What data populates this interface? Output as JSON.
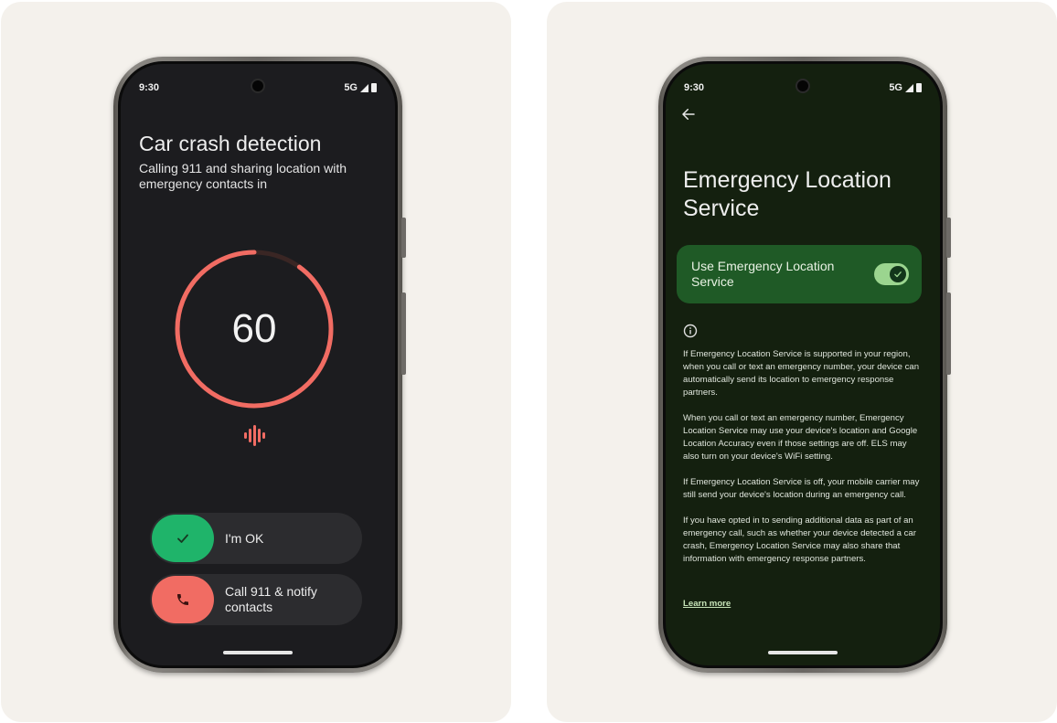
{
  "left_phone": {
    "status": {
      "time": "9:30",
      "network": "5G"
    },
    "title": "Car crash detection",
    "subtitle": "Calling 911 and sharing location with emergency contacts in",
    "countdown": {
      "value": "60",
      "progress_fraction": 0.9,
      "ring_color": "#f16c63"
    },
    "actions": {
      "ok_label": "I'm OK",
      "call_label": "Call 911 & notify contacts"
    },
    "colors": {
      "ok_green": "#1fb46a",
      "call_red": "#f16c63"
    }
  },
  "right_phone": {
    "status": {
      "time": "9:30",
      "network": "5G"
    },
    "title": "Emergency Location Service",
    "toggle": {
      "label": "Use Emergency Location Service",
      "checked": true
    },
    "paragraphs": [
      "If Emergency Location Service is supported in your region, when you call or text an emergency number, your device can automatically send its location to emergency response partners.",
      "When you call or text an emergency number, Emergency Location Service may use your device's location and Google Location Accuracy even if those settings are off. ELS may also turn on your device's WiFi setting.",
      "If Emergency Location Service is off, your mobile carrier may still send your device's location during an emergency call.",
      "If you have opted in to sending additional data as part of an emergency call, such as whether your device detected a car crash, Emergency Location Service may also share that information with emergency response partners."
    ],
    "learn_more": "Learn more",
    "colors": {
      "toggle_card": "#1f5a26",
      "toggle_track": "#9bd58f"
    }
  }
}
